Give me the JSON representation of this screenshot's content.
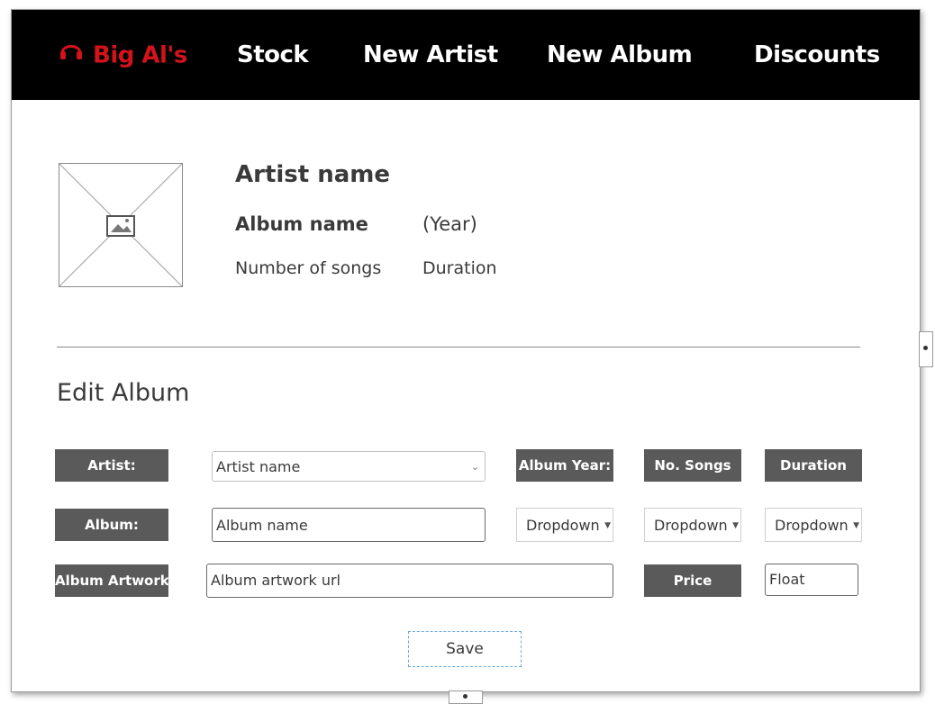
{
  "nav": {
    "brand": "Big Al's",
    "items": [
      "Stock",
      "New Artist",
      "New Album",
      "Discounts"
    ]
  },
  "album": {
    "artist_name": "Artist name",
    "album_name": "Album name",
    "year": "(Year)",
    "songs": "Number of songs",
    "duration": "Duration"
  },
  "edit": {
    "title": "Edit Album",
    "labels": {
      "artist": "Artist:",
      "album": "Album:",
      "artwork": "Album Artwork",
      "album_year": "Album Year:",
      "no_songs": "No. Songs",
      "duration": "Duration",
      "price": "Price"
    },
    "fields": {
      "artist_select": "Artist name",
      "album_input": "Album name",
      "artwork_input": "Album artwork url",
      "year_dropdown": "Dropdown",
      "songs_dropdown": "Dropdown",
      "duration_dropdown": "Dropdown",
      "price_input": "Float"
    },
    "save_label": "Save"
  },
  "colors": {
    "brand": "#d4121b",
    "navbar": "#000000",
    "label_bg": "#5a5a5a"
  },
  "icons": {
    "brand": "headphones-icon",
    "image": "image-placeholder-icon"
  }
}
